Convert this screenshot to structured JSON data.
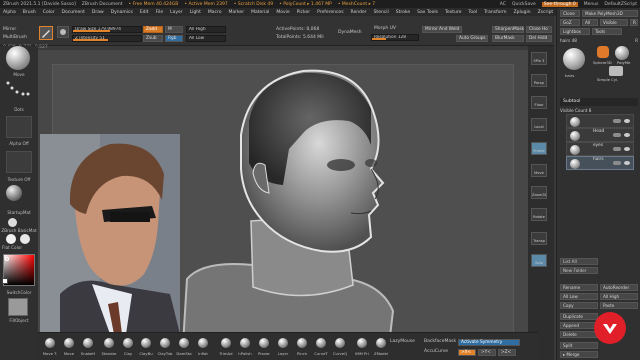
{
  "titlebar": {
    "app": "ZBrush 2021.5.1 [Davide Sasso]",
    "doc": "ZBrush Document",
    "mem": "• Free Mem 40.424GB",
    "active_mem": "• Active Mem 2397",
    "scratch": "• Scratch Disk 49",
    "polycount": "• PolyCount ▸ 1.467 MP",
    "meshcount": "• MeshCount ▸ 7",
    "ac": "AC",
    "quicksave": "QuickSave",
    "seethrough": "See-through 0",
    "menus": "Menus",
    "script": "DefaultZScript"
  },
  "menubar": {
    "items": [
      "Alpha",
      "Brush",
      "Color",
      "Document",
      "Draw",
      "Dynamics",
      "Edit",
      "File",
      "Layer",
      "Light",
      "Macro",
      "Marker",
      "Material",
      "Movie",
      "Picker",
      "Preferences",
      "Render",
      "Stencil",
      "Stroke",
      "Sax Tools",
      "Texture",
      "Tool",
      "Transform",
      "Zplugin",
      "Zscript",
      "Help"
    ]
  },
  "coords": "0.426,-0.771,-0.527",
  "toolbar": {
    "mirror": "Mirror",
    "multibrush": "MultiBrush",
    "draw_size_label": "Draw Size",
    "draw_size_val": "179.98974",
    "z_intensity_label": "Z Intensity",
    "z_intensity_val": "51",
    "zadd": "Zadd",
    "zsub": "Zsub",
    "rgb": "Rgb",
    "m": "M",
    "all_high": "All High",
    "all_low": "All Low",
    "active_points": "ActivePoints: 8,068",
    "total_points": "TotalPoints: 5.644 Mil",
    "dynamesh": "DynaMesh",
    "morph_uv": "Morph UV",
    "resolution": "Resolution 128",
    "mirror_weld": "Mirror And Weld",
    "auto_groups": "Auto Groups",
    "sharpen_mask": "SharpenMask",
    "blur_mask": "BlurMask",
    "close_holes": "Close Ho",
    "del_hidden": "Del Hidd"
  },
  "leftshelf": {
    "move": "Move",
    "dots": "Dots",
    "alpha_off": "Alpha Off",
    "texture_off": "Texture Off",
    "startup_mat": "StartupMat",
    "dbasic": "ZBrush BasicMat",
    "flat_color": "Flat Color",
    "skin_shade": "SkinShade4",
    "switch_color": "SwitchColor",
    "fill_object": "FillObject"
  },
  "rightdock": {
    "buttons": [
      "SPix 3",
      "Persp",
      "Floor",
      "Local",
      "Frame",
      "Move",
      "Zoom3D",
      "Rotate",
      "Transp",
      "Solo"
    ]
  },
  "rpanel": {
    "clone": "Clone",
    "make_polymesh": "Make PolyMesh3D",
    "goz": "GoZ",
    "all": "All",
    "visible": "Visible",
    "r": "R",
    "lightbox": "Lightbox",
    "tools": "Tools",
    "hairs": "hairs",
    "hairs_num": "48",
    "tool_r": "R",
    "sphere_label": "Sphere3D",
    "polymesh_label": "PolyMe",
    "simple_cyl": "Simple Cyl.",
    "hairs_thumb": "hairs",
    "subtool_title": "Subtool",
    "visible_count": "Visible Count 8",
    "subtools": [
      "",
      "Head",
      "eyes",
      "hairs"
    ],
    "list_all": "List All",
    "new_folder": "New Folder",
    "rename": "Rename",
    "autoreorder": "AutoReorder",
    "all_low": "All Low",
    "all_high": "All High",
    "copy": "Copy",
    "paste": "Paste",
    "duplicate": "Duplicate",
    "append": "Append",
    "delete": "Delete",
    "split": "Split",
    "merge": "▸ Merge"
  },
  "brushbar": {
    "brushes": [
      "Move T.",
      "Move",
      "SnakeH",
      "Standar",
      "Clay",
      "ClayBu",
      "ClayTub",
      "DamSta",
      "Inflat",
      "TrimAd",
      "hPolish",
      "Planar",
      "Layer",
      "Pinch",
      "CurveT",
      "CurveQ",
      "IMM Pri",
      "ZModel"
    ],
    "lazymouse": "LazyMouse",
    "backface": "BackfaceMask",
    "accucurve": "AccuCurve",
    "activate_sym": "Activate Symmetry",
    "x_axis": ">X<",
    "y_axis": ">Y<",
    "z_axis": ">Z<"
  },
  "colors": {
    "accent": "#e0832a",
    "brand": "#e01f28"
  }
}
